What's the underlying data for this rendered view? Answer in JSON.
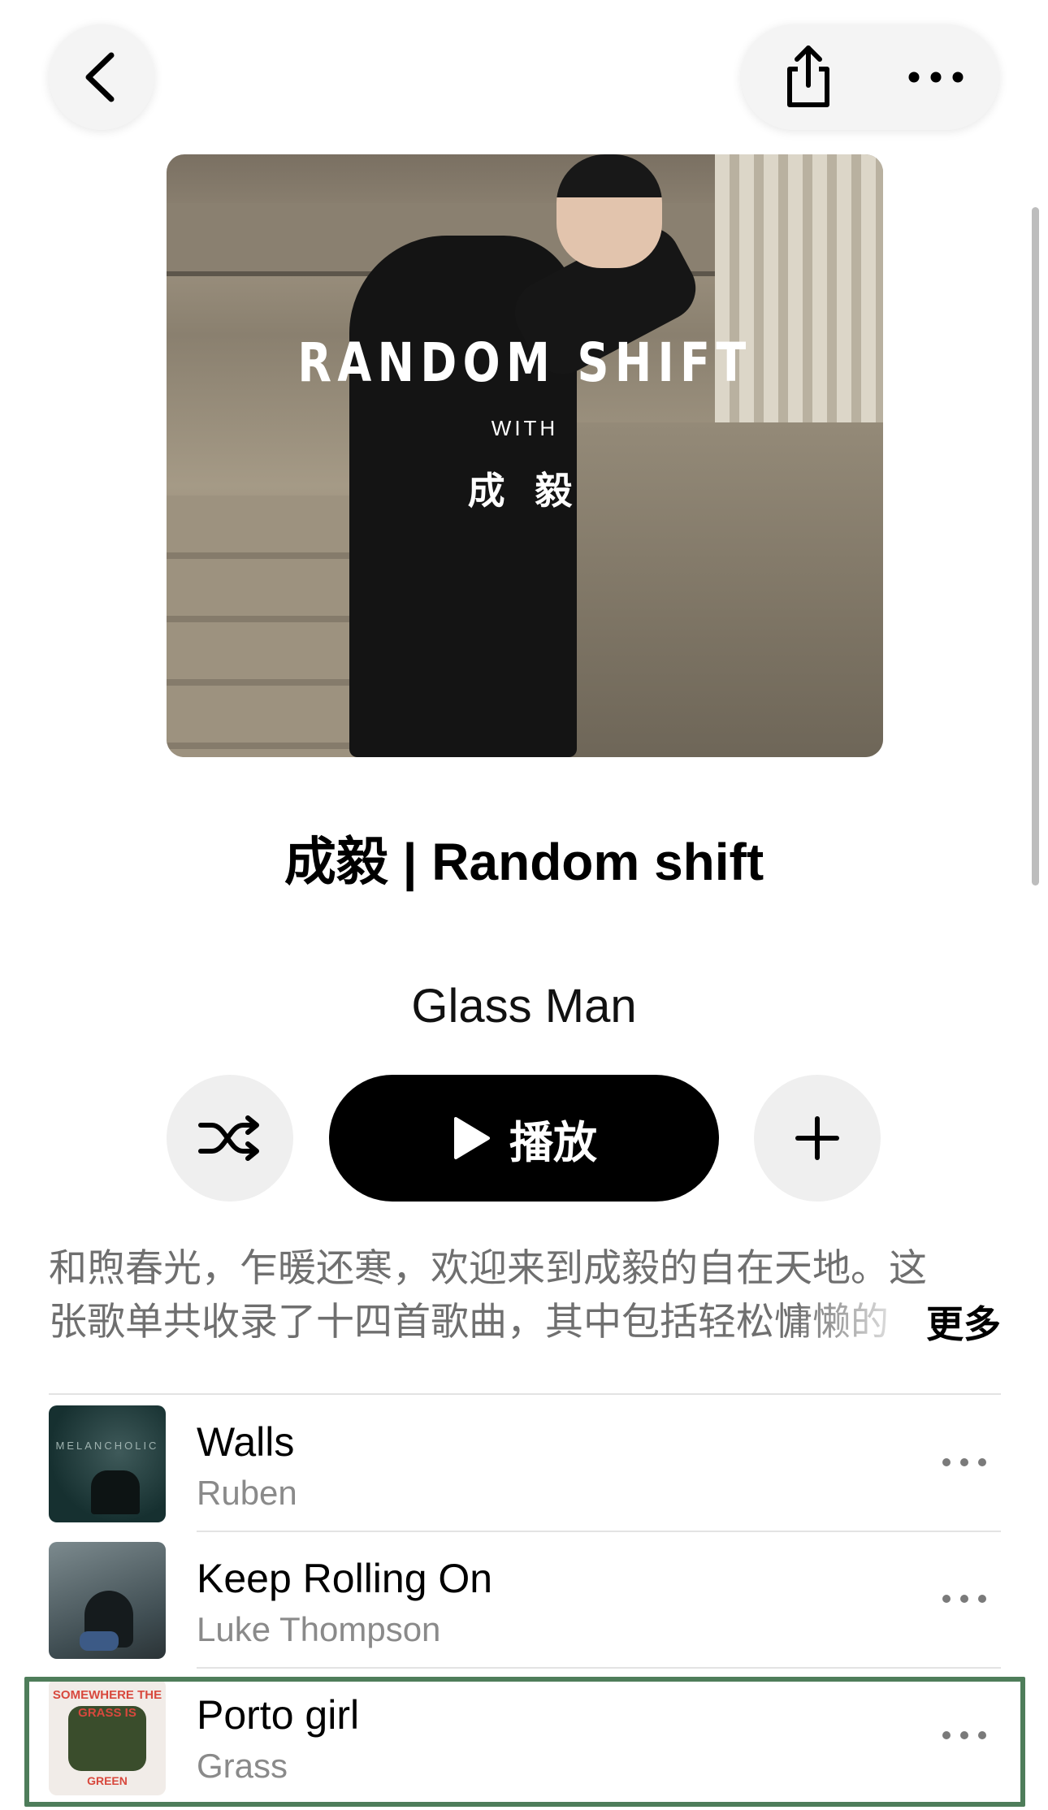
{
  "nav": {
    "back_icon": "chevron-left-icon",
    "share_icon": "share-icon",
    "more_icon": "ellipsis-icon"
  },
  "cover": {
    "headline": "RANDOM SHIFT",
    "with_label": "WITH",
    "artist_name": "成 毅"
  },
  "playlist": {
    "title": "成毅 | Random shift",
    "curator": "Glass Man"
  },
  "actions": {
    "shuffle_icon": "shuffle-icon",
    "play_icon": "play-icon",
    "play_label": "播放",
    "add_icon": "plus-icon"
  },
  "description": {
    "line1": "和煦春光，乍暖还寒，欢迎来到成毅的自在天地。这",
    "line2": "张歌单共收录了十四首歌曲，其中包括轻松慵懒的",
    "more_label": "更多"
  },
  "tracks": [
    {
      "title": "Walls",
      "artist": "Ruben",
      "art_text": "MELANCHOLIC"
    },
    {
      "title": "Keep Rolling On",
      "artist": "Luke Thompson",
      "art_text": ""
    },
    {
      "title": "Porto girl",
      "artist": "Grass",
      "art_text": "SOMEWHERE THE GRASS IS",
      "art_text_bottom": "GREEN"
    }
  ],
  "colors": {
    "accent_black": "#000000",
    "muted_text": "#8a8a8a",
    "button_bg": "#efefef",
    "highlight_border": "#4e7d5a"
  }
}
